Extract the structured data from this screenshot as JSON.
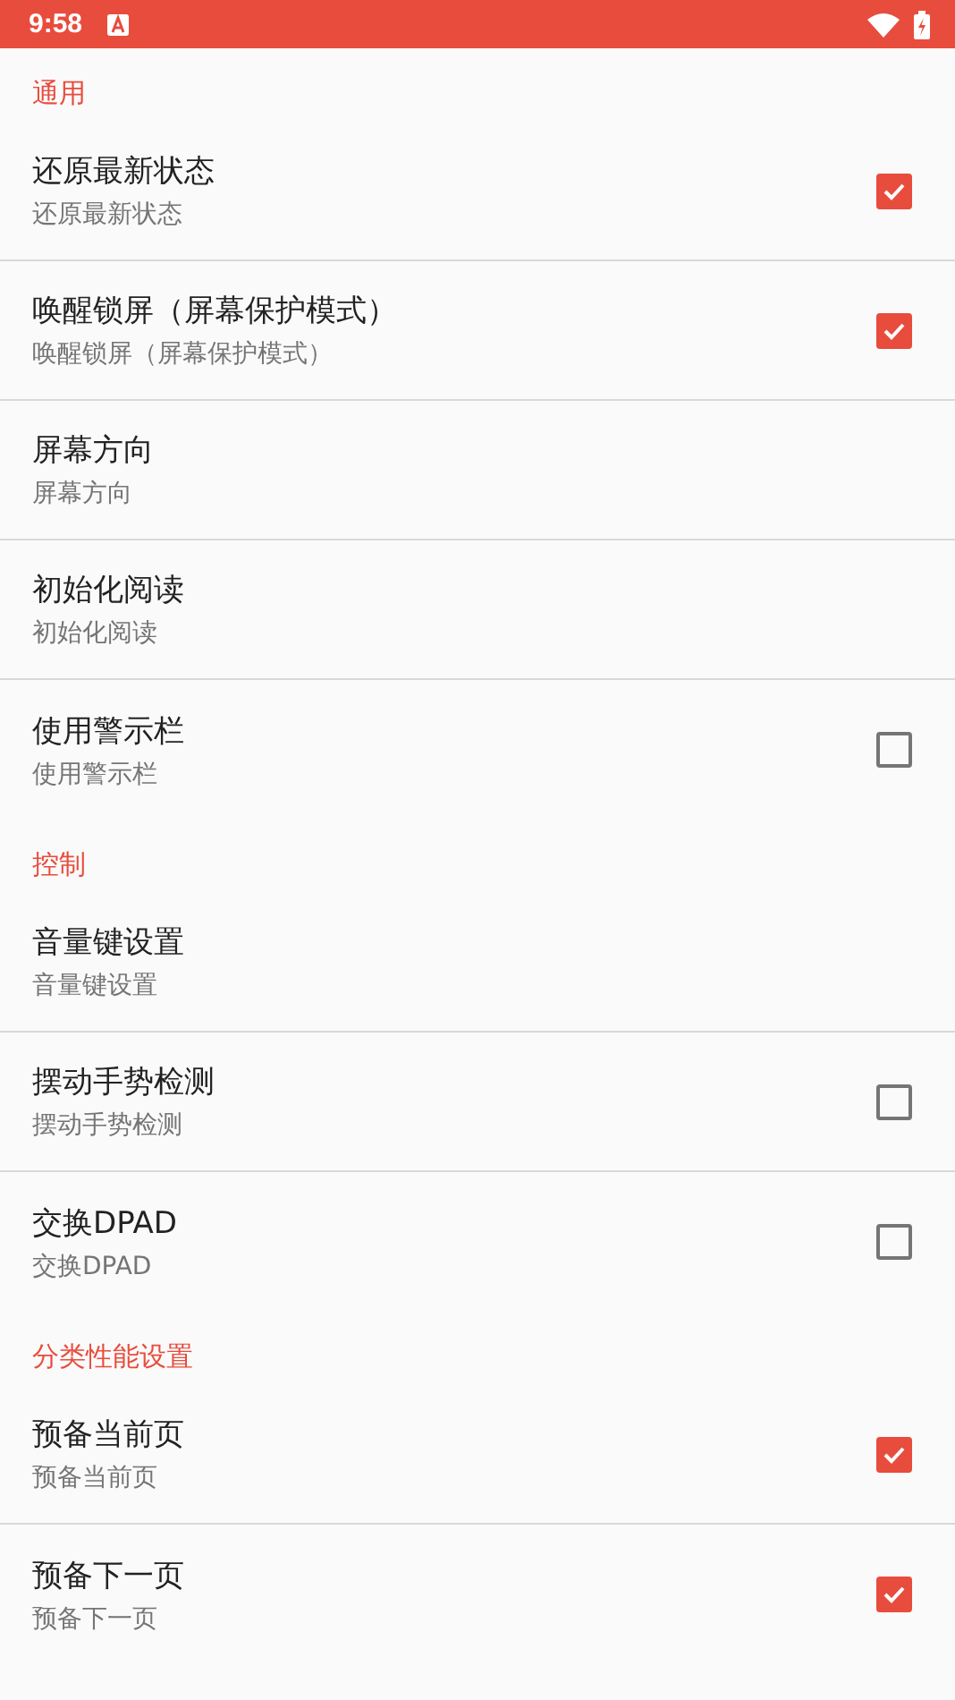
{
  "status_bar": {
    "time": "9:58"
  },
  "sections": [
    {
      "header": "通用",
      "items": [
        {
          "kind": "checkbox",
          "title": "还原最新状态",
          "summary": "还原最新状态",
          "checked": true
        },
        {
          "kind": "checkbox",
          "title": "唤醒锁屏（屏幕保护模式）",
          "summary": "唤醒锁屏（屏幕保护模式）",
          "checked": true
        },
        {
          "kind": "plain",
          "title": "屏幕方向",
          "summary": "屏幕方向"
        },
        {
          "kind": "plain",
          "title": "初始化阅读",
          "summary": "初始化阅读"
        },
        {
          "kind": "checkbox",
          "title": "使用警示栏",
          "summary": "使用警示栏",
          "checked": false
        }
      ]
    },
    {
      "header": "控制",
      "items": [
        {
          "kind": "plain",
          "title": "音量键设置",
          "summary": "音量键设置"
        },
        {
          "kind": "checkbox",
          "title": "摆动手势检测",
          "summary": "摆动手势检测",
          "checked": false
        },
        {
          "kind": "checkbox",
          "title": "交换DPAD",
          "summary": "交换DPAD",
          "checked": false
        }
      ]
    },
    {
      "header": "分类性能设置",
      "items": [
        {
          "kind": "checkbox",
          "title": "预备当前页",
          "summary": "预备当前页",
          "checked": true
        },
        {
          "kind": "checkbox",
          "title": "预备下一页",
          "summary": "预备下一页",
          "checked": true
        }
      ]
    }
  ]
}
